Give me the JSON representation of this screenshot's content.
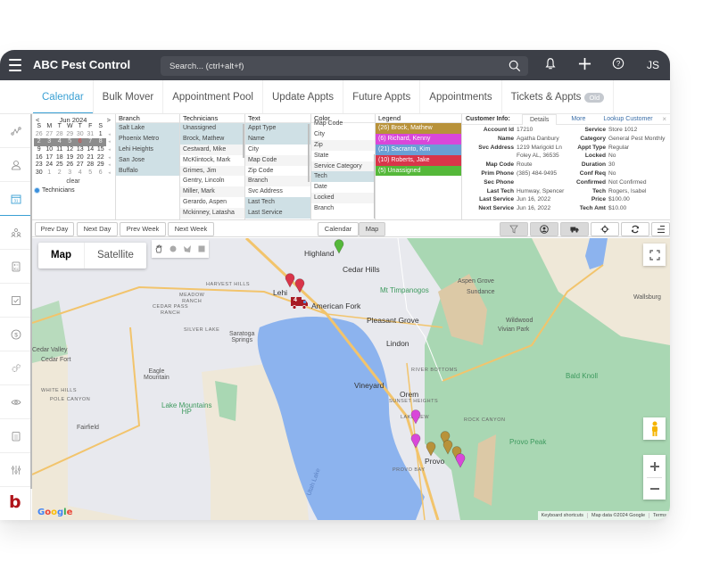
{
  "app": {
    "title": "ABC Pest Control",
    "search_placeholder": "Search... (ctrl+alt+f)",
    "user_initials": "JS",
    "brand_letter": "b",
    "icons": [
      "menu-icon",
      "search-icon",
      "bell-icon",
      "plus-icon",
      "help-icon"
    ]
  },
  "tabs": [
    {
      "label": "Calendar",
      "active": true
    },
    {
      "label": "Bulk Mover",
      "active": false
    },
    {
      "label": "Appointment Pool",
      "active": false
    },
    {
      "label": "Update Appts",
      "active": false
    },
    {
      "label": "Future Appts",
      "active": false
    },
    {
      "label": "Appointments",
      "active": false
    },
    {
      "label": "Tickets & Appts",
      "active": false,
      "badge": "Old"
    }
  ],
  "sidebar": {
    "items": [
      {
        "icon": "route-icon"
      },
      {
        "icon": "user-icon"
      },
      {
        "icon": "calendar-icon",
        "active": true
      },
      {
        "icon": "team-icon"
      },
      {
        "icon": "calculator-icon"
      },
      {
        "icon": "checkbox-icon"
      },
      {
        "icon": "dollar-icon"
      },
      {
        "icon": "gears-icon"
      },
      {
        "icon": "eye-icon"
      },
      {
        "icon": "clipboard-icon"
      },
      {
        "icon": "sliders-icon"
      }
    ]
  },
  "calendar": {
    "prev": "<",
    "next": ">",
    "month_label": "Jun 2024",
    "weekdays": [
      "S",
      "M",
      "T",
      "W",
      "T",
      "F",
      "S"
    ],
    "weeks": [
      [
        "26",
        "27",
        "28",
        "29",
        "30",
        "31",
        "1"
      ],
      [
        "2",
        "3",
        "4",
        "5",
        "6",
        "7",
        "8"
      ],
      [
        "9",
        "10",
        "11",
        "12",
        "13",
        "14",
        "15"
      ],
      [
        "16",
        "17",
        "18",
        "19",
        "20",
        "21",
        "22"
      ],
      [
        "23",
        "24",
        "25",
        "26",
        "27",
        "28",
        "29"
      ],
      [
        "30",
        "1",
        "2",
        "3",
        "4",
        "5",
        "6"
      ]
    ],
    "selected_week": 1,
    "today": "6",
    "clear_label": "clear",
    "radio_label": "Technicians"
  },
  "filters": {
    "branch": {
      "header": "Branch",
      "items": [
        "Salt Lake",
        "Phoenix Metro",
        "Lehi Heights",
        "San Jose",
        "Buffalo"
      ]
    },
    "technicians": {
      "header": "Technicians",
      "items": [
        "Unassigned",
        "Brock, Mathew",
        "Cestward, Mike",
        "McKlintock, Mark",
        "Grimes, Jim",
        "Gentry, Lincoln",
        "Miller, Mark",
        "Gerardo, Aspen",
        "Mckinney, Latasha"
      ]
    },
    "text": {
      "header": "Text",
      "items": [
        "Appt Type",
        "Name",
        "City",
        "Map Code",
        "Zip Code",
        "Branch",
        "Svc Address",
        "Last Tech",
        "Last Service"
      ]
    },
    "color": {
      "header": "Color",
      "items": [
        "Map Code",
        "City",
        "Zip",
        "State",
        "Service Category",
        "Tech",
        "Date",
        "Locked",
        "Branch"
      ]
    },
    "legend": {
      "header": "Legend",
      "items": [
        {
          "label": "(26) Brock, Mathew",
          "color": "#b8923a"
        },
        {
          "label": "(6) Richard, Kenny",
          "color": "#d947d9"
        },
        {
          "label": "(21) Sacranto, Kim",
          "color": "#6a9fd4"
        },
        {
          "label": "(10) Roberts, Jake",
          "color": "#d9354a"
        },
        {
          "label": "(5) Unassigned",
          "color": "#55b83a"
        }
      ]
    }
  },
  "customer_info": {
    "title": "Customer Info:",
    "tabs": [
      "Details",
      "More",
      "Lookup Customer"
    ],
    "close": "×",
    "left": [
      {
        "label": "Account Id",
        "value": "17210"
      },
      {
        "label": "Name",
        "value": "Agatha Danbury"
      },
      {
        "label": "Svc Address",
        "value": "1219 Marigold Ln"
      },
      {
        "label": "",
        "value": "Foley AL, 36535"
      },
      {
        "label": "Map Code",
        "value": "Route"
      },
      {
        "label": "Prim Phone",
        "value": "(385) 484-9495"
      },
      {
        "label": "Sec Phone",
        "value": ""
      },
      {
        "label": "Last Tech",
        "value": "Humway, Spencer"
      },
      {
        "label": "Last Service",
        "value": "Jun 16, 2022"
      },
      {
        "label": "Next Service",
        "value": "Jun 16, 2022"
      }
    ],
    "right": [
      {
        "label": "Service",
        "value": "Store 1012"
      },
      {
        "label": "Category",
        "value": "General Pest Monthly"
      },
      {
        "label": "Appt Type",
        "value": "Regular"
      },
      {
        "label": "Locked",
        "value": "No"
      },
      {
        "label": "Duration",
        "value": "30"
      },
      {
        "label": "Conf Req",
        "value": "No"
      },
      {
        "label": "Confirmed",
        "value": "Not Confirmed"
      },
      {
        "label": "Tech",
        "value": "Rogers, Isabel"
      },
      {
        "label": "Price",
        "value": "$100.00"
      },
      {
        "label": "Tech Amt",
        "value": "$10.00"
      }
    ]
  },
  "controls": {
    "nav": [
      "Prev Day",
      "Next Day",
      "Prev Week",
      "Next Week"
    ],
    "view": [
      {
        "label": "Calendar",
        "active": false
      },
      {
        "label": "Map",
        "active": true
      }
    ],
    "tools": [
      {
        "icon": "filter-icon",
        "active": true
      },
      {
        "icon": "user-circle-icon",
        "active": true
      },
      {
        "icon": "truck-icon",
        "active": true
      },
      {
        "icon": "crosshair-icon",
        "active": false
      },
      {
        "icon": "refresh-icon",
        "active": false
      },
      {
        "icon": "list-icon",
        "active": false
      }
    ]
  },
  "map": {
    "type_buttons": [
      "Map",
      "Satellite"
    ],
    "active_type": "Map",
    "draw_tools": [
      "hand-icon",
      "circle-icon",
      "polygon-icon",
      "rectangle-icon"
    ],
    "truck_count": "4",
    "labels": [
      {
        "text": "Highland",
        "kind": "big"
      },
      {
        "text": "Cedar Hills",
        "kind": "big"
      },
      {
        "text": "Lehi",
        "kind": "big"
      },
      {
        "text": "American Fork",
        "kind": "big"
      },
      {
        "text": "Pleasant Grove",
        "kind": "big"
      },
      {
        "text": "Mt Timpanogos",
        "kind": "green"
      },
      {
        "text": "Aspen Grove",
        "kind": "normal"
      },
      {
        "text": "Sundance",
        "kind": "normal"
      },
      {
        "text": "Wallsburg",
        "kind": "normal"
      },
      {
        "text": "Wildwood",
        "kind": "normal"
      },
      {
        "text": "Vivian Park",
        "kind": "normal"
      },
      {
        "text": "HARVEST HILLS",
        "kind": "small"
      },
      {
        "text": "MEADOW RANCH",
        "kind": "small"
      },
      {
        "text": "CEDAR PASS RANCH",
        "kind": "small"
      },
      {
        "text": "SILVER LAKE",
        "kind": "small"
      },
      {
        "text": "Saratoga Springs",
        "kind": "normal"
      },
      {
        "text": "Lindon",
        "kind": "big"
      },
      {
        "text": "RIVER BOTTOMS",
        "kind": "small"
      },
      {
        "text": "Cedar Valley",
        "kind": "normal"
      },
      {
        "text": "Cedar Fort",
        "kind": "normal"
      },
      {
        "text": "Eagle Mountain",
        "kind": "normal"
      },
      {
        "text": "Vineyard",
        "kind": "big"
      },
      {
        "text": "Orem",
        "kind": "big"
      },
      {
        "text": "Bald Knoll",
        "kind": "green"
      },
      {
        "text": "WHITE HILLS",
        "kind": "small"
      },
      {
        "text": "POLE CANYON",
        "kind": "small"
      },
      {
        "text": "SUNSET HEIGHTS",
        "kind": "small"
      },
      {
        "text": "LAKEVIEW",
        "kind": "small"
      },
      {
        "text": "ROCK CANYON",
        "kind": "small"
      },
      {
        "text": "Lake Mountains HP",
        "kind": "green"
      },
      {
        "text": "Provo Peak",
        "kind": "green"
      },
      {
        "text": "Fairfield",
        "kind": "normal"
      },
      {
        "text": "Provo",
        "kind": "big"
      },
      {
        "text": "PROVO BAY",
        "kind": "small"
      },
      {
        "text": "Utah Lake",
        "kind": "water"
      }
    ],
    "google_logo": "Google",
    "attribution": [
      "Keyboard shortcuts",
      "Map data ©2024 Google",
      "Terms"
    ]
  }
}
